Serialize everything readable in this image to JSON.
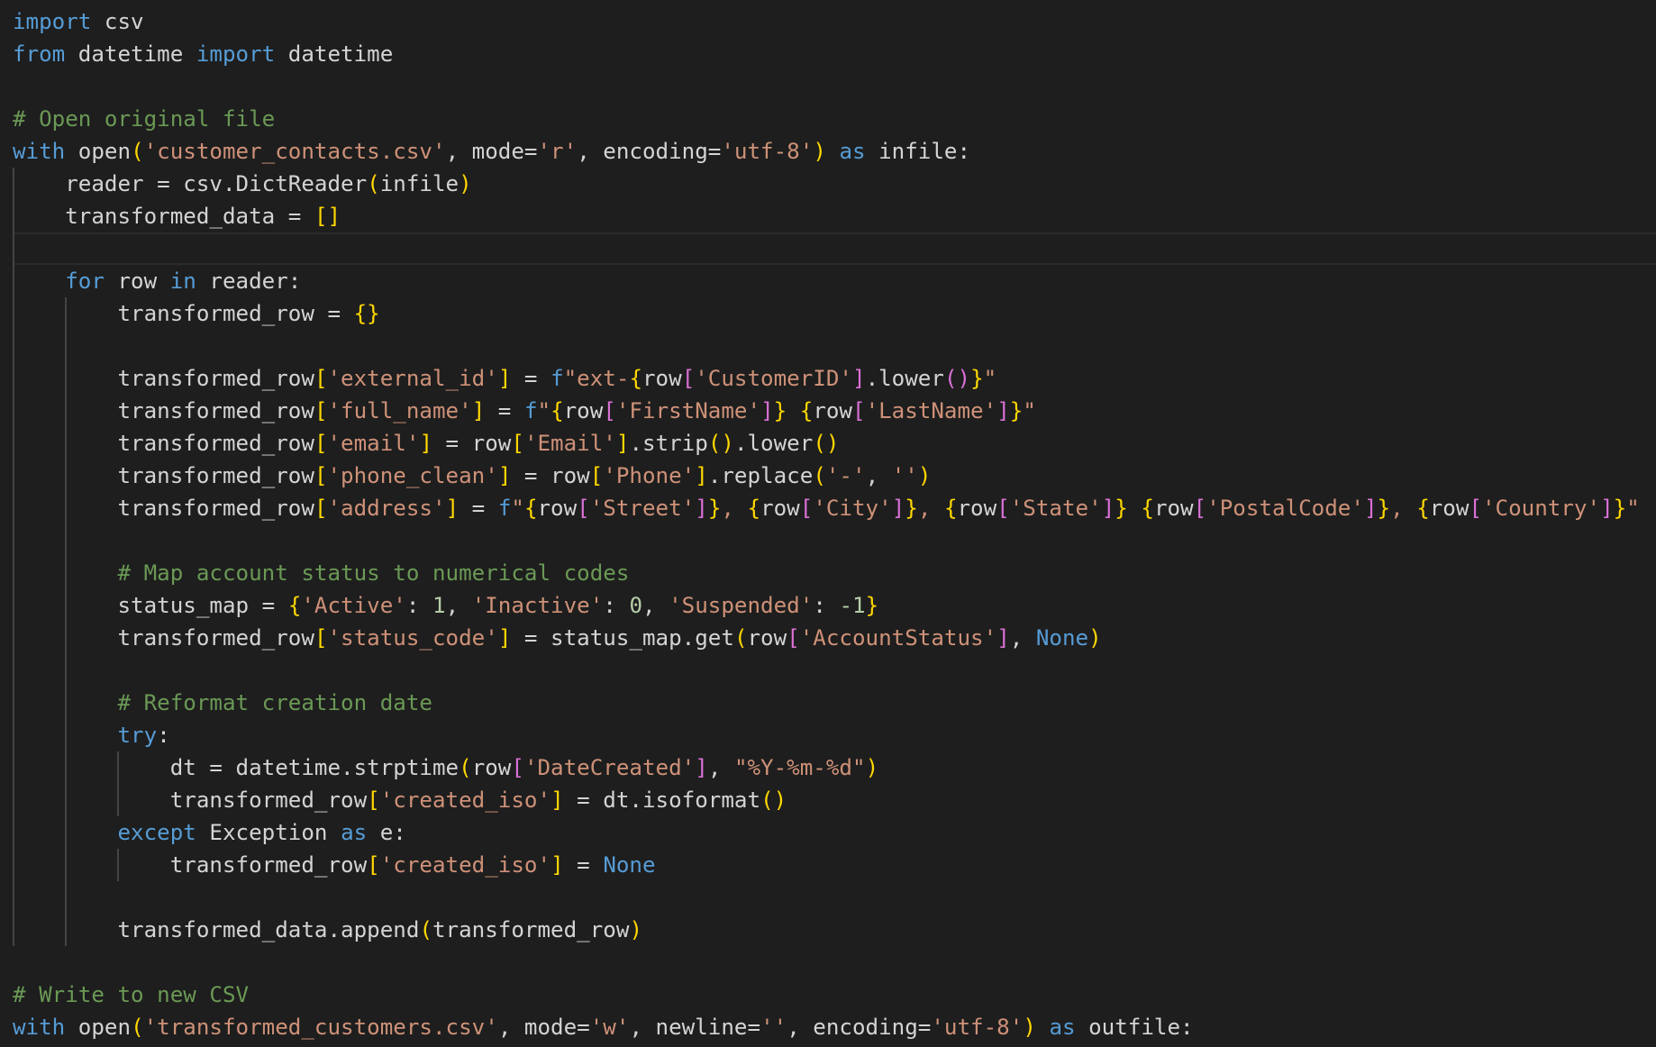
{
  "editor": {
    "language": "python",
    "theme_colors": {
      "background": "#1e1e1e",
      "keyword": "#569cd6",
      "string": "#ce9178",
      "comment": "#6a9955",
      "number": "#b5cea8",
      "text": "#d4d4d4",
      "bracket_level_1": "#ffd700",
      "bracket_level_2": "#da70d6"
    },
    "lines": [
      [
        {
          "t": "import",
          "c": "kw"
        },
        {
          "t": " csv",
          "c": "tx"
        }
      ],
      [
        {
          "t": "from",
          "c": "kw"
        },
        {
          "t": " datetime ",
          "c": "tx"
        },
        {
          "t": "import",
          "c": "kw"
        },
        {
          "t": " datetime",
          "c": "tx"
        }
      ],
      [],
      [
        {
          "t": "# Open original file",
          "c": "cmt"
        }
      ],
      [
        {
          "t": "with",
          "c": "kw"
        },
        {
          "t": " open",
          "c": "tx"
        },
        {
          "t": "(",
          "c": "p1"
        },
        {
          "t": "'customer_contacts.csv'",
          "c": "str"
        },
        {
          "t": ", mode=",
          "c": "tx"
        },
        {
          "t": "'r'",
          "c": "str"
        },
        {
          "t": ", encoding=",
          "c": "tx"
        },
        {
          "t": "'utf-8'",
          "c": "str"
        },
        {
          "t": ")",
          "c": "p1"
        },
        {
          "t": " ",
          "c": "tx"
        },
        {
          "t": "as",
          "c": "kw"
        },
        {
          "t": " infile:",
          "c": "tx"
        }
      ],
      [
        {
          "t": "    reader = csv.DictReader",
          "c": "tx"
        },
        {
          "t": "(",
          "c": "p1"
        },
        {
          "t": "infile",
          "c": "tx"
        },
        {
          "t": ")",
          "c": "p1"
        }
      ],
      [
        {
          "t": "    transformed_data = ",
          "c": "tx"
        },
        {
          "t": "[]",
          "c": "p1"
        }
      ],
      [],
      [
        {
          "t": "    ",
          "c": "tx"
        },
        {
          "t": "for",
          "c": "kw"
        },
        {
          "t": " row ",
          "c": "tx"
        },
        {
          "t": "in",
          "c": "kw"
        },
        {
          "t": " reader:",
          "c": "tx"
        }
      ],
      [
        {
          "t": "        transformed_row = ",
          "c": "tx"
        },
        {
          "t": "{}",
          "c": "p1"
        }
      ],
      [],
      [
        {
          "t": "        transformed_row",
          "c": "tx"
        },
        {
          "t": "[",
          "c": "p1"
        },
        {
          "t": "'external_id'",
          "c": "str"
        },
        {
          "t": "]",
          "c": "p1"
        },
        {
          "t": " = ",
          "c": "tx"
        },
        {
          "t": "f",
          "c": "kw"
        },
        {
          "t": "\"ext-",
          "c": "str"
        },
        {
          "t": "{",
          "c": "p1"
        },
        {
          "t": "row",
          "c": "tx"
        },
        {
          "t": "[",
          "c": "p2"
        },
        {
          "t": "'CustomerID'",
          "c": "str"
        },
        {
          "t": "]",
          "c": "p2"
        },
        {
          "t": ".lower",
          "c": "tx"
        },
        {
          "t": "()",
          "c": "p2"
        },
        {
          "t": "}",
          "c": "p1"
        },
        {
          "t": "\"",
          "c": "str"
        }
      ],
      [
        {
          "t": "        transformed_row",
          "c": "tx"
        },
        {
          "t": "[",
          "c": "p1"
        },
        {
          "t": "'full_name'",
          "c": "str"
        },
        {
          "t": "]",
          "c": "p1"
        },
        {
          "t": " = ",
          "c": "tx"
        },
        {
          "t": "f",
          "c": "kw"
        },
        {
          "t": "\"",
          "c": "str"
        },
        {
          "t": "{",
          "c": "p1"
        },
        {
          "t": "row",
          "c": "tx"
        },
        {
          "t": "[",
          "c": "p2"
        },
        {
          "t": "'FirstName'",
          "c": "str"
        },
        {
          "t": "]",
          "c": "p2"
        },
        {
          "t": "}",
          "c": "p1"
        },
        {
          "t": " ",
          "c": "str"
        },
        {
          "t": "{",
          "c": "p1"
        },
        {
          "t": "row",
          "c": "tx"
        },
        {
          "t": "[",
          "c": "p2"
        },
        {
          "t": "'LastName'",
          "c": "str"
        },
        {
          "t": "]",
          "c": "p2"
        },
        {
          "t": "}",
          "c": "p1"
        },
        {
          "t": "\"",
          "c": "str"
        }
      ],
      [
        {
          "t": "        transformed_row",
          "c": "tx"
        },
        {
          "t": "[",
          "c": "p1"
        },
        {
          "t": "'email'",
          "c": "str"
        },
        {
          "t": "]",
          "c": "p1"
        },
        {
          "t": " = row",
          "c": "tx"
        },
        {
          "t": "[",
          "c": "p1"
        },
        {
          "t": "'Email'",
          "c": "str"
        },
        {
          "t": "]",
          "c": "p1"
        },
        {
          "t": ".strip",
          "c": "tx"
        },
        {
          "t": "()",
          "c": "p1"
        },
        {
          "t": ".lower",
          "c": "tx"
        },
        {
          "t": "()",
          "c": "p1"
        }
      ],
      [
        {
          "t": "        transformed_row",
          "c": "tx"
        },
        {
          "t": "[",
          "c": "p1"
        },
        {
          "t": "'phone_clean'",
          "c": "str"
        },
        {
          "t": "]",
          "c": "p1"
        },
        {
          "t": " = row",
          "c": "tx"
        },
        {
          "t": "[",
          "c": "p1"
        },
        {
          "t": "'Phone'",
          "c": "str"
        },
        {
          "t": "]",
          "c": "p1"
        },
        {
          "t": ".replace",
          "c": "tx"
        },
        {
          "t": "(",
          "c": "p1"
        },
        {
          "t": "'-'",
          "c": "str"
        },
        {
          "t": ", ",
          "c": "tx"
        },
        {
          "t": "''",
          "c": "str"
        },
        {
          "t": ")",
          "c": "p1"
        }
      ],
      [
        {
          "t": "        transformed_row",
          "c": "tx"
        },
        {
          "t": "[",
          "c": "p1"
        },
        {
          "t": "'address'",
          "c": "str"
        },
        {
          "t": "]",
          "c": "p1"
        },
        {
          "t": " = ",
          "c": "tx"
        },
        {
          "t": "f",
          "c": "kw"
        },
        {
          "t": "\"",
          "c": "str"
        },
        {
          "t": "{",
          "c": "p1"
        },
        {
          "t": "row",
          "c": "tx"
        },
        {
          "t": "[",
          "c": "p2"
        },
        {
          "t": "'Street'",
          "c": "str"
        },
        {
          "t": "]",
          "c": "p2"
        },
        {
          "t": "}",
          "c": "p1"
        },
        {
          "t": ", ",
          "c": "str"
        },
        {
          "t": "{",
          "c": "p1"
        },
        {
          "t": "row",
          "c": "tx"
        },
        {
          "t": "[",
          "c": "p2"
        },
        {
          "t": "'City'",
          "c": "str"
        },
        {
          "t": "]",
          "c": "p2"
        },
        {
          "t": "}",
          "c": "p1"
        },
        {
          "t": ", ",
          "c": "str"
        },
        {
          "t": "{",
          "c": "p1"
        },
        {
          "t": "row",
          "c": "tx"
        },
        {
          "t": "[",
          "c": "p2"
        },
        {
          "t": "'State'",
          "c": "str"
        },
        {
          "t": "]",
          "c": "p2"
        },
        {
          "t": "}",
          "c": "p1"
        },
        {
          "t": " ",
          "c": "str"
        },
        {
          "t": "{",
          "c": "p1"
        },
        {
          "t": "row",
          "c": "tx"
        },
        {
          "t": "[",
          "c": "p2"
        },
        {
          "t": "'PostalCode'",
          "c": "str"
        },
        {
          "t": "]",
          "c": "p2"
        },
        {
          "t": "}",
          "c": "p1"
        },
        {
          "t": ", ",
          "c": "str"
        },
        {
          "t": "{",
          "c": "p1"
        },
        {
          "t": "row",
          "c": "tx"
        },
        {
          "t": "[",
          "c": "p2"
        },
        {
          "t": "'Country'",
          "c": "str"
        },
        {
          "t": "]",
          "c": "p2"
        },
        {
          "t": "}",
          "c": "p1"
        },
        {
          "t": "\"",
          "c": "str"
        }
      ],
      [],
      [
        {
          "t": "        ",
          "c": "tx"
        },
        {
          "t": "# Map account status to numerical codes",
          "c": "cmt"
        }
      ],
      [
        {
          "t": "        status_map = ",
          "c": "tx"
        },
        {
          "t": "{",
          "c": "p1"
        },
        {
          "t": "'Active'",
          "c": "str"
        },
        {
          "t": ": ",
          "c": "tx"
        },
        {
          "t": "1",
          "c": "num"
        },
        {
          "t": ", ",
          "c": "tx"
        },
        {
          "t": "'Inactive'",
          "c": "str"
        },
        {
          "t": ": ",
          "c": "tx"
        },
        {
          "t": "0",
          "c": "num"
        },
        {
          "t": ", ",
          "c": "tx"
        },
        {
          "t": "'Suspended'",
          "c": "str"
        },
        {
          "t": ": ",
          "c": "tx"
        },
        {
          "t": "-1",
          "c": "num"
        },
        {
          "t": "}",
          "c": "p1"
        }
      ],
      [
        {
          "t": "        transformed_row",
          "c": "tx"
        },
        {
          "t": "[",
          "c": "p1"
        },
        {
          "t": "'status_code'",
          "c": "str"
        },
        {
          "t": "]",
          "c": "p1"
        },
        {
          "t": " = status_map.get",
          "c": "tx"
        },
        {
          "t": "(",
          "c": "p1"
        },
        {
          "t": "row",
          "c": "tx"
        },
        {
          "t": "[",
          "c": "p2"
        },
        {
          "t": "'AccountStatus'",
          "c": "str"
        },
        {
          "t": "]",
          "c": "p2"
        },
        {
          "t": ", ",
          "c": "tx"
        },
        {
          "t": "None",
          "c": "kw"
        },
        {
          "t": ")",
          "c": "p1"
        }
      ],
      [],
      [
        {
          "t": "        ",
          "c": "tx"
        },
        {
          "t": "# Reformat creation date",
          "c": "cmt"
        }
      ],
      [
        {
          "t": "        ",
          "c": "tx"
        },
        {
          "t": "try",
          "c": "kw"
        },
        {
          "t": ":",
          "c": "tx"
        }
      ],
      [
        {
          "t": "            dt = datetime.strptime",
          "c": "tx"
        },
        {
          "t": "(",
          "c": "p1"
        },
        {
          "t": "row",
          "c": "tx"
        },
        {
          "t": "[",
          "c": "p2"
        },
        {
          "t": "'DateCreated'",
          "c": "str"
        },
        {
          "t": "]",
          "c": "p2"
        },
        {
          "t": ", ",
          "c": "tx"
        },
        {
          "t": "\"%Y-%m-%d\"",
          "c": "str"
        },
        {
          "t": ")",
          "c": "p1"
        }
      ],
      [
        {
          "t": "            transformed_row",
          "c": "tx"
        },
        {
          "t": "[",
          "c": "p1"
        },
        {
          "t": "'created_iso'",
          "c": "str"
        },
        {
          "t": "]",
          "c": "p1"
        },
        {
          "t": " = dt.isoformat",
          "c": "tx"
        },
        {
          "t": "()",
          "c": "p1"
        }
      ],
      [
        {
          "t": "        ",
          "c": "tx"
        },
        {
          "t": "except",
          "c": "kw"
        },
        {
          "t": " Exception ",
          "c": "tx"
        },
        {
          "t": "as",
          "c": "kw"
        },
        {
          "t": " e:",
          "c": "tx"
        }
      ],
      [
        {
          "t": "            transformed_row",
          "c": "tx"
        },
        {
          "t": "[",
          "c": "p1"
        },
        {
          "t": "'created_iso'",
          "c": "str"
        },
        {
          "t": "]",
          "c": "p1"
        },
        {
          "t": " = ",
          "c": "tx"
        },
        {
          "t": "None",
          "c": "kw"
        }
      ],
      [],
      [
        {
          "t": "        transformed_data.append",
          "c": "tx"
        },
        {
          "t": "(",
          "c": "p1"
        },
        {
          "t": "transformed_row",
          "c": "tx"
        },
        {
          "t": ")",
          "c": "p1"
        }
      ],
      [],
      [
        {
          "t": "# Write to new CSV",
          "c": "cmt"
        }
      ],
      [
        {
          "t": "with",
          "c": "kw"
        },
        {
          "t": " open",
          "c": "tx"
        },
        {
          "t": "(",
          "c": "p1"
        },
        {
          "t": "'transformed_customers.csv'",
          "c": "str"
        },
        {
          "t": ", mode=",
          "c": "tx"
        },
        {
          "t": "'w'",
          "c": "str"
        },
        {
          "t": ", newline=",
          "c": "tx"
        },
        {
          "t": "''",
          "c": "str"
        },
        {
          "t": ", encoding=",
          "c": "tx"
        },
        {
          "t": "'utf-8'",
          "c": "str"
        },
        {
          "t": ")",
          "c": "p1"
        },
        {
          "t": " ",
          "c": "tx"
        },
        {
          "t": "as",
          "c": "kw"
        },
        {
          "t": " outfile:",
          "c": "tx"
        }
      ]
    ]
  }
}
